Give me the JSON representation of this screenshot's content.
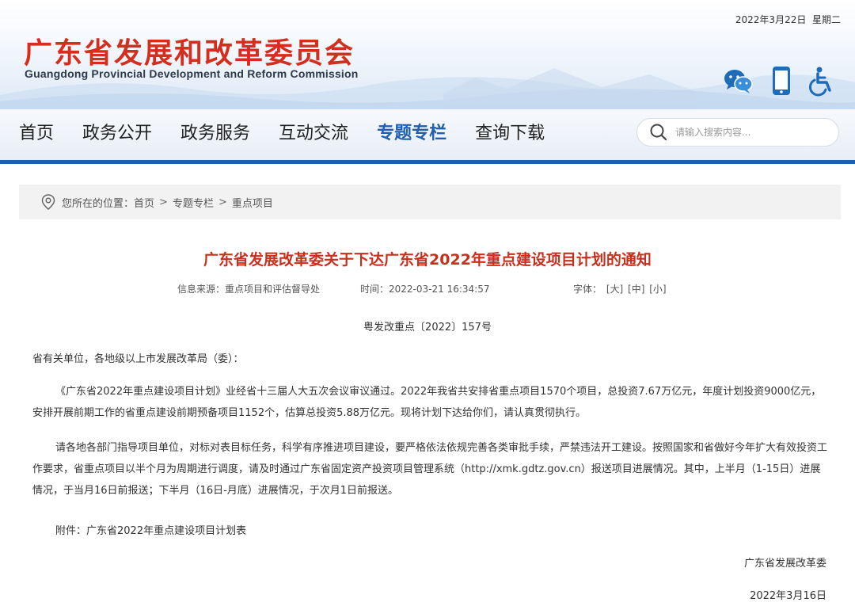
{
  "header": {
    "date": "2022年3月22日",
    "weekday": "星期二",
    "title_cn": "广东省发展和改革委员会",
    "title_en": "Guangdong Provincial Development and Reform Commission",
    "brand_color": "#d42e1e",
    "icons": [
      "wechat-icon",
      "mobile-icon",
      "accessibility-icon"
    ]
  },
  "nav": {
    "items": [
      {
        "label": "首页"
      },
      {
        "label": "政务公开"
      },
      {
        "label": "政务服务"
      },
      {
        "label": "互动交流"
      },
      {
        "label": "专题专栏",
        "active": true
      },
      {
        "label": "查询下载"
      }
    ],
    "accent_color": "#1f5fae",
    "search_placeholder": "请输入搜索内容..."
  },
  "breadcrumb": {
    "prefix": "您所在的位置：",
    "items": [
      "首页",
      "专题专栏",
      "重点项目"
    ],
    "separator": ">"
  },
  "article": {
    "title": "广东省发展改革委关于下达广东省2022年重点建设项目计划的通知",
    "title_color": "#c8301e",
    "source_label": "信息来源：",
    "source": "重点项目和评估督导处",
    "time_label": "时间：",
    "time": "2022-03-21 16:34:57",
    "font_label": "字体：",
    "font_sizes": [
      "[大]",
      "[中]",
      "[小]"
    ],
    "doc_number": "粤发改重点〔2022〕157号",
    "addressee": "省有关单位，各地级以上市发展改革局（委）：",
    "paragraph_1": "《广东省2022年重点建设项目计划》业经省十三届人大五次会议审议通过。2022年我省共安排省重点项目1570个项目，总投资7.67万亿元，年度计划投资9000亿元，安排开展前期工作的省重点建设前期预备项目1152个，估算总投资5.88万亿元。现将计划下达给你们，请认真贯彻执行。",
    "paragraph_2": "请各地各部门指导项目单位，对标对表目标任务，科学有序推进项目建设，要严格依法依规完善各类审批手续，严禁违法开工建设。按照国家和省做好今年扩大有效投资工作要求，省重点项目以半个月为周期进行调度，请及时通过广东省固定资产投资项目管理系统（http://xmk.gdtz.gov.cn）报送项目进展情况。其中，上半月（1-15日）进展情况，于当月16日前报送；下半月（16日-月底）进展情况，于次月1日前报送。",
    "attachment": "附件：广东省2022年重点建设项目计划表",
    "signature": "广东省发展改革委",
    "sign_date": "2022年3月16日"
  }
}
